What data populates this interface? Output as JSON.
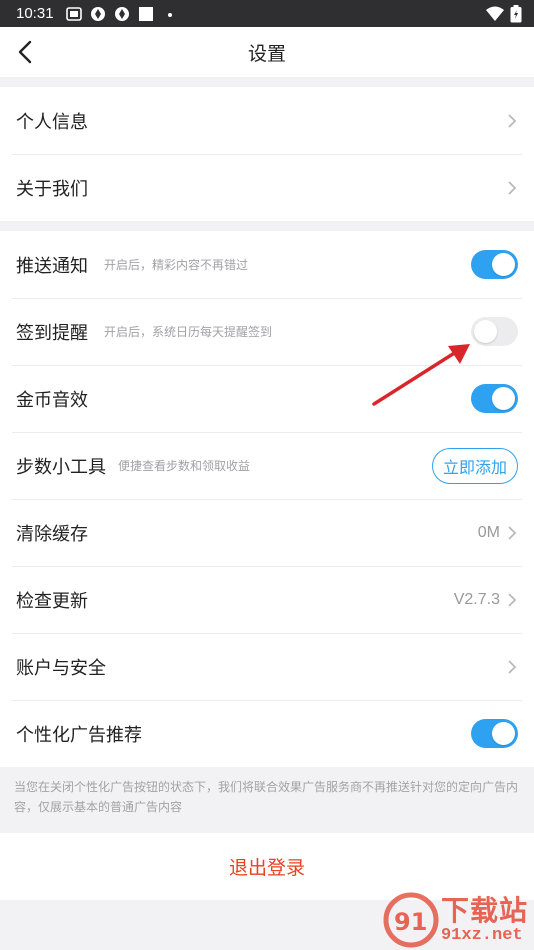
{
  "status_bar": {
    "time": "10:31",
    "icons": [
      "sim-card-icon",
      "browser-icon",
      "browser-icon",
      "square-icon",
      "dot-icon",
      "wifi-icon",
      "battery-icon"
    ]
  },
  "nav": {
    "title": "设置",
    "back_icon": "back-chevron-icon"
  },
  "group1": [
    {
      "label": "个人信息"
    },
    {
      "label": "关于我们"
    }
  ],
  "group2": {
    "push": {
      "label": "推送通知",
      "sub": "开启后，精彩内容不再错过",
      "toggle": "on"
    },
    "signin": {
      "label": "签到提醒",
      "sub": "开启后，系统日历每天提醒签到",
      "toggle": "off"
    },
    "coin": {
      "label": "金币音效",
      "toggle": "on"
    },
    "steps": {
      "label": "步数小工具",
      "sub": "便捷查看步数和领取收益",
      "button": "立即添加"
    },
    "cache": {
      "label": "清除缓存",
      "value": "0M"
    },
    "update": {
      "label": "检查更新",
      "value": "V2.7.3"
    },
    "account": {
      "label": "账户与安全"
    },
    "ads": {
      "label": "个性化广告推荐",
      "toggle": "on"
    }
  },
  "notice": "当您在关闭个性化广告按钮的状态下，我们将联合效果广告服务商不再推送针对您的定向广告内容，仅展示基本的普通广告内容",
  "logout": "退出登录",
  "watermark": {
    "big": "下载站",
    "small": "91xz.net",
    "logo": "91"
  },
  "colors": {
    "accent": "#2ea2f0",
    "danger": "#e8421f",
    "annotation_arrow": "#d9262b"
  }
}
